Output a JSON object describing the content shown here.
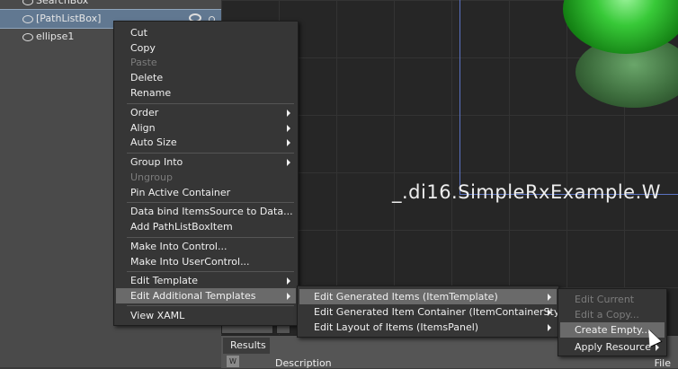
{
  "objects_panel": {
    "items": [
      {
        "label": "SearchBox"
      },
      {
        "label": "[PathListBox]"
      },
      {
        "label": "ellipse1"
      }
    ]
  },
  "artboard": {
    "title": "_.di16.SimpleRxExample.W"
  },
  "results": {
    "tab_label": "Results",
    "badge": "W",
    "description_header": "Description",
    "file_header": "File"
  },
  "context_menu": {
    "items": [
      {
        "label": "Cut",
        "enabled": true
      },
      {
        "label": "Copy",
        "enabled": true
      },
      {
        "label": "Paste",
        "enabled": false
      },
      {
        "label": "Delete",
        "enabled": true
      },
      {
        "label": "Rename",
        "enabled": true
      },
      {
        "label": "Order",
        "enabled": true,
        "submenu": true
      },
      {
        "label": "Align",
        "enabled": true,
        "submenu": true
      },
      {
        "label": "Auto Size",
        "enabled": true,
        "submenu": true
      },
      {
        "label": "Group Into",
        "enabled": true,
        "submenu": true
      },
      {
        "label": "Ungroup",
        "enabled": false
      },
      {
        "label": "Pin Active Container",
        "enabled": true
      },
      {
        "label": "Data bind ItemsSource to Data...",
        "enabled": true
      },
      {
        "label": "Add PathListBoxItem",
        "enabled": true
      },
      {
        "label": "Make Into Control...",
        "enabled": true
      },
      {
        "label": "Make Into UserControl...",
        "enabled": true
      },
      {
        "label": "Edit Template",
        "enabled": true,
        "submenu": true
      },
      {
        "label": "Edit Additional Templates",
        "enabled": true,
        "submenu": true,
        "highlighted": true
      },
      {
        "label": "View XAML",
        "enabled": true
      }
    ]
  },
  "templates_submenu": {
    "items": [
      {
        "label": "Edit Generated Items (ItemTemplate)",
        "highlighted": true,
        "submenu": true
      },
      {
        "label": "Edit Generated Item Container (ItemContainerStyle)",
        "submenu": true
      },
      {
        "label": "Edit Layout of Items (ItemsPanel)",
        "submenu": true
      }
    ]
  },
  "item_template_submenu": {
    "items": [
      {
        "label": "Edit Current",
        "enabled": false
      },
      {
        "label": "Edit a Copy...",
        "enabled": false
      },
      {
        "label": "Create Empty...",
        "enabled": true,
        "highlighted": true
      },
      {
        "label": "Apply Resource",
        "enabled": true,
        "submenu": true
      }
    ]
  }
}
